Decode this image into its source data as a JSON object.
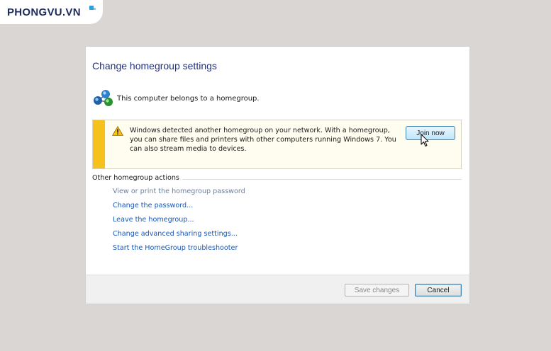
{
  "watermark": {
    "text": "PHONGVU.VN"
  },
  "dialog": {
    "title": "Change homegroup settings",
    "status": {
      "icon": "homegroup-icon",
      "text": "This computer belongs to a homegroup."
    },
    "notice": {
      "icon": "warning-icon",
      "accent_color": "#f6c11b",
      "message": "Windows detected another homegroup on your network. With a homegroup, you can share files and printers with other computers running Windows 7. You can also stream media to devices.",
      "join_label": "Join now"
    },
    "other_actions": {
      "header": "Other homegroup actions",
      "links": [
        "View or print the homegroup password",
        "Change the password...",
        "Leave the homegroup...",
        "Change advanced sharing settings...",
        "Start the HomeGroup troubleshooter"
      ]
    },
    "footer": {
      "save_label": "Save changes",
      "cancel_label": "Cancel"
    }
  }
}
